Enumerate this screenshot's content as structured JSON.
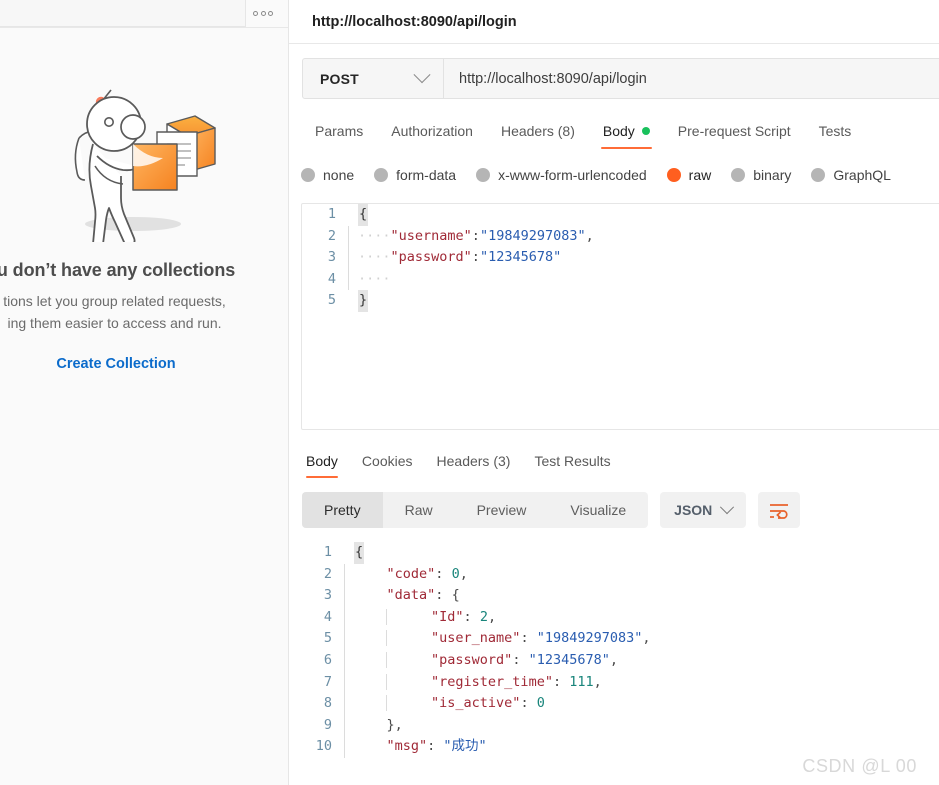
{
  "sidebar": {
    "more_button": "•••",
    "empty_title": "u don’t have any collections",
    "empty_desc_line1": "tions let you group related requests,",
    "empty_desc_line2": "ing them easier to access and run.",
    "create_collection": "Create Collection"
  },
  "request": {
    "title": "http://localhost:8090/api/login",
    "method": "POST",
    "url": "http://localhost:8090/api/login",
    "tabs": [
      {
        "label": "Params",
        "active": false
      },
      {
        "label": "Authorization",
        "active": false
      },
      {
        "label": "Headers (8)",
        "active": false
      },
      {
        "label": "Body",
        "active": true
      },
      {
        "label": "Pre-request Script",
        "active": false
      },
      {
        "label": "Tests",
        "active": false
      }
    ],
    "headers_count": "8",
    "body_types": [
      {
        "label": "none",
        "selected": false
      },
      {
        "label": "form-data",
        "selected": false
      },
      {
        "label": "x-www-form-urlencoded",
        "selected": false
      },
      {
        "label": "raw",
        "selected": true
      },
      {
        "label": "binary",
        "selected": false
      },
      {
        "label": "GraphQL",
        "selected": false
      }
    ],
    "body_lines": [
      {
        "no": "1",
        "text": "{"
      },
      {
        "no": "2",
        "key": "\"username\"",
        "sep": ":",
        "value": "\"19849297083\"",
        "tail": ","
      },
      {
        "no": "3",
        "key": "\"password\"",
        "sep": ":",
        "value": "\"12345678\"",
        "tail": ""
      },
      {
        "no": "4",
        "text": ""
      },
      {
        "no": "5",
        "text": "}"
      }
    ]
  },
  "response": {
    "tabs": [
      {
        "label": "Body",
        "active": true
      },
      {
        "label": "Cookies",
        "active": false
      },
      {
        "label": "Headers (3)",
        "active": false
      },
      {
        "label": "Test Results",
        "active": false
      }
    ],
    "view_modes": [
      {
        "label": "Pretty",
        "active": true
      },
      {
        "label": "Raw",
        "active": false
      },
      {
        "label": "Preview",
        "active": false
      },
      {
        "label": "Visualize",
        "active": false
      }
    ],
    "format": "JSON",
    "wrap_icon": "word-wrap-icon",
    "body_lines": [
      {
        "no": "1",
        "indent": 0,
        "text": "{"
      },
      {
        "no": "2",
        "indent": 1,
        "key": "\"code\"",
        "sep": ": ",
        "num": "0",
        "tail": ","
      },
      {
        "no": "3",
        "indent": 1,
        "key": "\"data\"",
        "sep": ": ",
        "brace": "{",
        "tail": ""
      },
      {
        "no": "4",
        "indent": 2,
        "key": "\"Id\"",
        "sep": ": ",
        "num": "2",
        "tail": ","
      },
      {
        "no": "5",
        "indent": 2,
        "key": "\"user_name\"",
        "sep": ": ",
        "str": "\"19849297083\"",
        "tail": ","
      },
      {
        "no": "6",
        "indent": 2,
        "key": "\"password\"",
        "sep": ": ",
        "str": "\"12345678\"",
        "tail": ","
      },
      {
        "no": "7",
        "indent": 2,
        "key": "\"register_time\"",
        "sep": ": ",
        "num": "111",
        "tail": ","
      },
      {
        "no": "8",
        "indent": 2,
        "key": "\"is_active\"",
        "sep": ": ",
        "num": "0",
        "tail": ""
      },
      {
        "no": "9",
        "indent": 1,
        "text": "},"
      },
      {
        "no": "10",
        "indent": 1,
        "key": "\"msg\"",
        "sep": ": ",
        "str": "\"成功\"",
        "tail": ""
      }
    ]
  },
  "watermark": "CSDN @L 00",
  "colors": {
    "accent": "#ff6c37",
    "link": "#0b6bcb",
    "green_dot": "#19c15c",
    "count_green": "#0c9b4b",
    "json_key": "#a02a37",
    "json_string": "#2a5db0",
    "json_number": "#19857b"
  }
}
